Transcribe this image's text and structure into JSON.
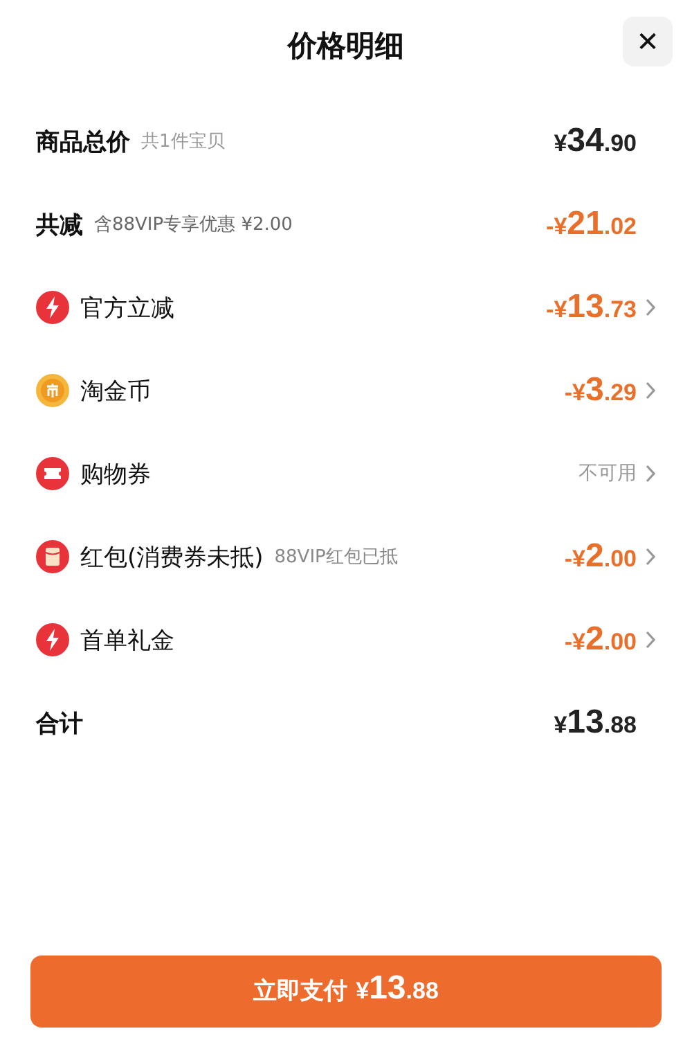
{
  "header": {
    "title": "价格明细",
    "close": "✕"
  },
  "rows": [
    {
      "kind": "summary",
      "label": "商品总价",
      "note": "共1件宝贝",
      "value": "¥34.90",
      "discount": false,
      "has_arrow": false
    },
    {
      "kind": "summary",
      "label": "共减",
      "note": "含88VIP专享优惠 ¥2.00",
      "value": "-¥21.02",
      "discount": true,
      "has_arrow": false
    },
    {
      "kind": "bolt",
      "label": "官方立减",
      "value": "-¥13.73",
      "discount": true,
      "has_arrow": true
    },
    {
      "kind": "coin",
      "label": "淘金币",
      "value": "-¥3.29",
      "discount": true,
      "has_arrow": true
    },
    {
      "kind": "ticket",
      "label": "购物券",
      "status": "不可用",
      "discount": false,
      "has_arrow": true
    },
    {
      "kind": "envelope",
      "label": "红包(消费券未抵)",
      "note": "88VIP红包已抵",
      "value": "-¥2.00",
      "discount": true,
      "has_arrow": true
    },
    {
      "kind": "bolt",
      "label": "首单礼金",
      "value": "-¥2.00",
      "discount": true,
      "has_arrow": true
    },
    {
      "kind": "summary",
      "label": "合计",
      "value": "¥13.88",
      "discount": false,
      "has_arrow": false
    }
  ],
  "pay_button": {
    "label": "立即支付",
    "price": "¥13.88"
  }
}
